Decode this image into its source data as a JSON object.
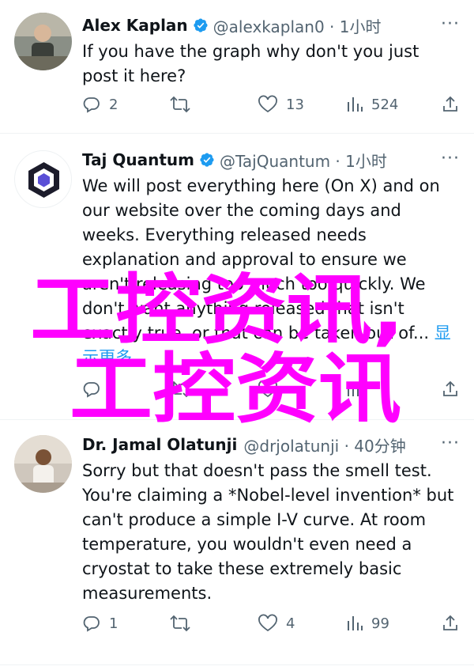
{
  "tweets": [
    {
      "name": "Alex Kaplan",
      "handle": "@alexkaplan0 · 1小时",
      "text": "If you have the graph why don't you just post it here?",
      "replies": "2",
      "retweets": "",
      "likes": "13",
      "views": "524"
    },
    {
      "name": "Taj Quantum",
      "handle": "@TajQuantum · 1小时",
      "text": "We will post everything here (On X) and on our website over the coming days and weeks. Everything released needs explanation and approval to ensure we aren't releasing too much too quickly. We don't want anything released that isn't exactly true, or that can be taken out of...",
      "show_more": "显示更多",
      "replies": "",
      "retweets": "",
      "likes": "",
      "views": ""
    },
    {
      "name": "Dr. Jamal Olatunji",
      "handle": "@drjolatunji · 40分钟",
      "text": "Sorry but that doesn't pass the smell test. You're claiming a *Nobel-level invention* but can't produce a simple I-V curve. At room temperature, you wouldn't even need a cryostat to take these extremely basic measurements.",
      "replies": "1",
      "retweets": "",
      "likes": "4",
      "views": "99"
    }
  ],
  "more_label": "···",
  "watermark": {
    "line1": "工控资讯,",
    "line2": "工控资讯",
    "color": "#ff00ff"
  },
  "colors": {
    "verified": "#1d9bf0",
    "secondary": "#536471",
    "link": "#1d9bf0"
  }
}
